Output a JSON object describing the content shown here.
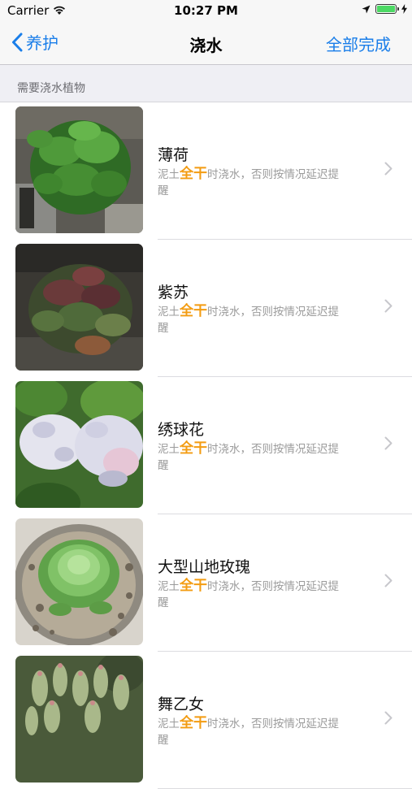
{
  "status_bar": {
    "carrier": "Carrier",
    "time": "10:27 PM"
  },
  "nav": {
    "back_label": "养护",
    "title": "浇水",
    "action_label": "全部完成"
  },
  "section": {
    "header": "需要浇水植物"
  },
  "colors": {
    "accent": "#1a7ee9",
    "highlight": "#f39c12",
    "battery": "#4cd964"
  },
  "plants": [
    {
      "name": "薄荷",
      "desc_prefix": "泥土",
      "desc_highlight": "全干",
      "desc_suffix": "时浇水，否则按情况延迟提醒",
      "photo": "mint-plant"
    },
    {
      "name": "紫苏",
      "desc_prefix": "泥土",
      "desc_highlight": "全干",
      "desc_suffix": "时浇水，否则按情况延迟提醒",
      "photo": "perilla-plant"
    },
    {
      "name": "绣球花",
      "desc_prefix": "泥土",
      "desc_highlight": "全干",
      "desc_suffix": "时浇水，否则按情况延迟提醒",
      "photo": "hydrangea-flower"
    },
    {
      "name": "大型山地玫瑰",
      "desc_prefix": "泥土",
      "desc_highlight": "全干",
      "desc_suffix": "时浇水，否则按情况延迟提醒",
      "photo": "mountain-rose-succulent"
    },
    {
      "name": "舞乙女",
      "desc_prefix": "泥土",
      "desc_highlight": "全干",
      "desc_suffix": "时浇水，否则按情况延迟提醒",
      "photo": "crassula-succulent"
    }
  ]
}
